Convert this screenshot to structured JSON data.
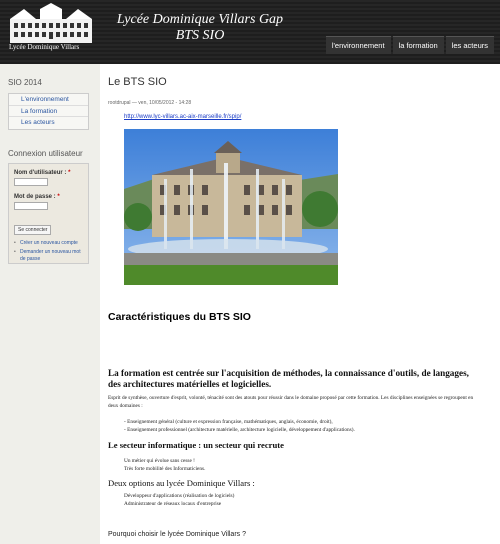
{
  "header": {
    "logo_text": "Lycée Dominique Villars",
    "title_line1": "Lycée Dominique Villars Gap",
    "title_line2": "BTS SIO",
    "nav": [
      "l'environnement",
      "la formation",
      "les acteurs"
    ]
  },
  "sidebar": {
    "menu_title": "SIO 2014",
    "menu_items": [
      "L'environnement",
      "La formation",
      "Les acteurs"
    ],
    "login_title": "Connexion utilisateur",
    "username_label": "Nom d'utilisateur :",
    "password_label": "Mot de passe :",
    "required_mark": "*",
    "login_button": "Se connecter",
    "create_account": "Créer un nouveau compte",
    "new_password": "Demander un nouveau mot de passe"
  },
  "main": {
    "title": "Le BTS SIO",
    "submitted": "rootdrupal — ven, 10/05/2012 - 14:28",
    "link": "http://www.lyc-villars.ac-aix-marseille.fr/spip/",
    "heading_characteristics": "Caractéristiques du BTS SIO",
    "heading_formation": "La formation est centrée sur l'acquisition de méthodes, la connaissance d'outils, de langages, des architectures matérielles et logicielles.",
    "paragraph": "Esprit de synthèse, ouverture d'esprit, volonté, ténacité sont des atouts pour réussir dans le domaine proposé par cette formation. Les disciplines enseignées se regroupent en deux domaines :",
    "bullets": [
      "- Enseignement général (culture et expression française, mathématiques, anglais, économie, droit),",
      "- Enseignement professionnel (architecture matérielle, architecture logicielle, développement d'applications)."
    ],
    "heading_secteur": "Le secteur informatique : un secteur qui recrute",
    "secteur_lines": [
      "Un métier qui évolue sans cesse !",
      "Très forte mobilité des Informaticiens."
    ],
    "heading_options": "Deux options au lycée Dominique Villars :",
    "option_lines": [
      "Développeur d'applications (réalisation de logiciels)",
      "Administrateur de réseaux locaux d'entreprise"
    ],
    "why_question": "Pourquoi choisir le lycée Dominique Villars ?"
  }
}
